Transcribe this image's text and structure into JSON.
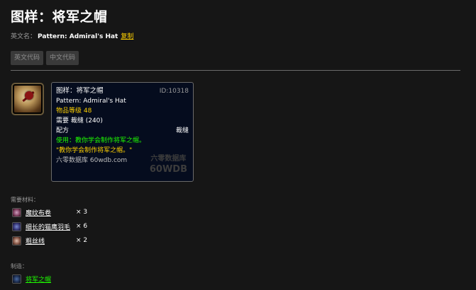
{
  "page": {
    "title": "图样：将军之帽"
  },
  "english_name": {
    "label": "英文名：",
    "value": "Pattern: Admiral's Hat",
    "copy_link": "复制"
  },
  "code_buttons": {
    "english": "英文代码",
    "chinese": "中文代码"
  },
  "tooltip": {
    "name": "图样：将军之帽",
    "id": "ID:10318",
    "english_name": "Pattern: Admiral's Hat",
    "item_level": "物品等级 48",
    "requires": "需要 裁缝 (240)",
    "type_left": "配方",
    "type_right": "裁缝",
    "use_text": "使用：教你学会制作将军之帽。",
    "flavor_text": "\"教你学会制作将军之帽。\"",
    "site": "六零数据库 60wdb.com",
    "watermark_line1": "六零数据库",
    "watermark_line2": "60WDB"
  },
  "materials": {
    "label": "需要材料：",
    "items": [
      {
        "name": "魔纹布卷",
        "qty": "× 3",
        "icon": "cloth-bolt-icon"
      },
      {
        "name": "细长的猫鹰羽毛",
        "qty": "× 6",
        "icon": "feather-icon"
      },
      {
        "name": "粗丝线",
        "qty": "× 2",
        "icon": "thread-icon"
      }
    ]
  },
  "crafts": {
    "label": "制造：",
    "item": {
      "name": "将军之帽",
      "icon": "hat-icon"
    }
  },
  "colors": {
    "background": "#161616",
    "tooltip_bg": "#050c1e",
    "gold": "#ffd100",
    "green": "#1eff00"
  }
}
